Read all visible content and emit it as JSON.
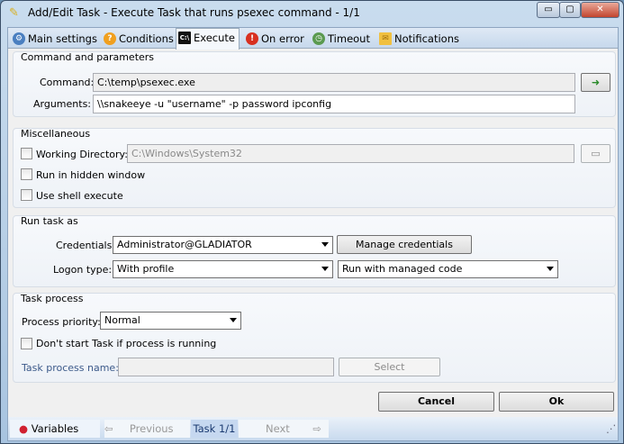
{
  "window": {
    "title": "Add/Edit Task - Execute Task that runs psexec command - 1/1"
  },
  "tabs": [
    {
      "label": "Main settings",
      "icon": "gear-icon"
    },
    {
      "label": "Conditions",
      "icon": "question-icon"
    },
    {
      "label": "Execute",
      "icon": "console-icon"
    },
    {
      "label": "On error",
      "icon": "error-icon"
    },
    {
      "label": "Timeout",
      "icon": "clock-icon"
    },
    {
      "label": "Notifications",
      "icon": "mail-icon"
    }
  ],
  "command_group": {
    "title": "Command and parameters",
    "command_label": "Command:",
    "command_value": "C:\\temp\\psexec.exe",
    "arguments_label": "Arguments:",
    "arguments_value": "\\\\snakeeye -u \"username\" -p password ipconfig"
  },
  "misc_group": {
    "title": "Miscellaneous",
    "working_dir_label": "Working Directory:",
    "working_dir_value": "C:\\Windows\\System32",
    "hidden_label": "Run in hidden window",
    "shell_label": "Use shell execute"
  },
  "runas_group": {
    "title": "Run task as",
    "credentials_label": "Credentials:",
    "credentials_value": "Administrator@GLADIATOR",
    "manage_label": "Manage credentials",
    "logon_label": "Logon type:",
    "logon_value": "With profile",
    "code_value": "Run with managed code"
  },
  "process_group": {
    "title": "Task process",
    "priority_label": "Process priority:",
    "priority_value": "Normal",
    "dont_start_label": "Don't start Task if process is running",
    "process_name_label": "Task process name:",
    "process_name_value": "",
    "select_label": "Select"
  },
  "buttons": {
    "cancel": "Cancel",
    "ok": "Ok"
  },
  "status": {
    "variables": "Variables",
    "previous": "Previous",
    "task": "Task 1/1",
    "next": "Next"
  }
}
